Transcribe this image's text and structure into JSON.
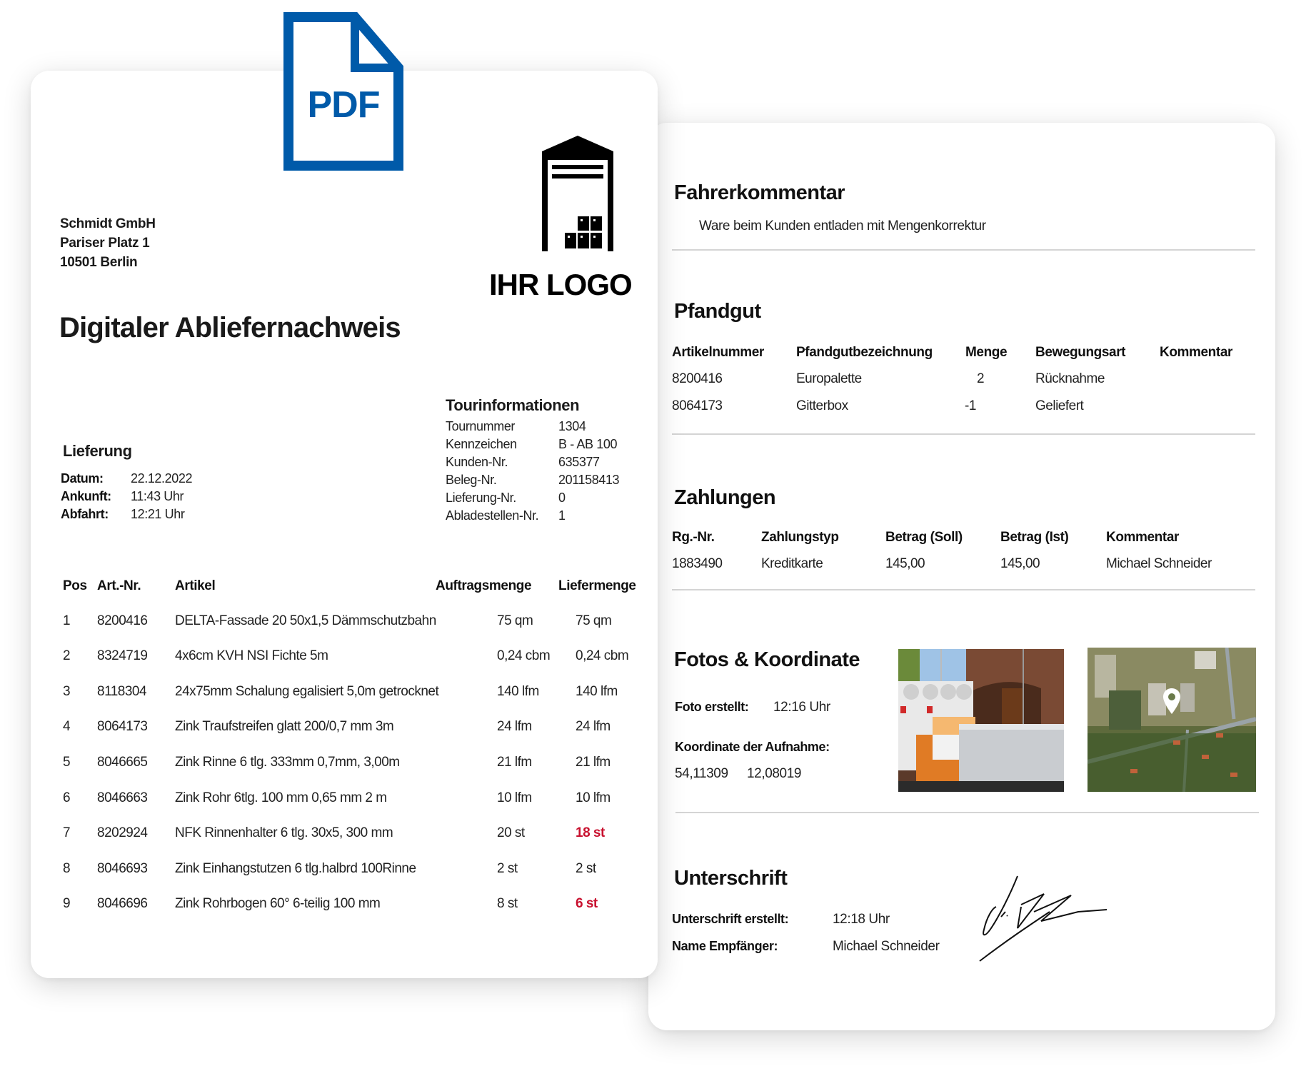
{
  "pdf_badge": {
    "label": "PDF",
    "color": "#005aa9"
  },
  "logo": {
    "text": "IHR LOGO",
    "icon": "warehouse-icon"
  },
  "sender": {
    "name": "Schmidt GmbH",
    "street": "Pariser Platz 1",
    "city": "10501 Berlin"
  },
  "document_title": "Digitaler Abliefernachweis",
  "tour_info": {
    "heading": "Tourinformationen",
    "rows": [
      {
        "label": "Tournummer",
        "value": "1304"
      },
      {
        "label": "Kennzeichen",
        "value": "B - AB 100"
      },
      {
        "label": "Kunden-Nr.",
        "value": "635377"
      },
      {
        "label": "Beleg-Nr.",
        "value": "201158413"
      },
      {
        "label": "Lieferung-Nr.",
        "value": "0"
      },
      {
        "label": "Abladestellen-Nr.",
        "value": "1"
      }
    ]
  },
  "delivery": {
    "heading": "Lieferung",
    "rows": [
      {
        "label": "Datum:",
        "value": "22.12.2022"
      },
      {
        "label": "Ankunft:",
        "value": "11:43 Uhr"
      },
      {
        "label": "Abfahrt:",
        "value": "12:21 Uhr"
      }
    ]
  },
  "items_table": {
    "headers": {
      "pos": "Pos",
      "art_nr": "Art.-Nr.",
      "artikel": "Artikel",
      "auftragsmenge": "Auftragsmenge",
      "liefermenge": "Liefermenge"
    },
    "rows": [
      {
        "pos": "1",
        "art_nr": "8200416",
        "artikel": "DELTA-Fassade 20 50x1,5 Dämmschutzbahn",
        "auftragsmenge": "75 qm",
        "liefermenge": "75 qm",
        "deviation": false
      },
      {
        "pos": "2",
        "art_nr": "8324719",
        "artikel": "4x6cm KVH NSI Fichte 5m",
        "auftragsmenge": "0,24 cbm",
        "liefermenge": "0,24 cbm",
        "deviation": false
      },
      {
        "pos": "3",
        "art_nr": "8118304",
        "artikel": "24x75mm Schalung egalisiert 5,0m getrocknet",
        "auftragsmenge": "140 lfm",
        "liefermenge": "140 lfm",
        "deviation": false
      },
      {
        "pos": "4",
        "art_nr": "8064173",
        "artikel": "Zink Traufstreifen glatt 200/0,7 mm 3m",
        "auftragsmenge": "24 lfm",
        "liefermenge": "24 lfm",
        "deviation": false
      },
      {
        "pos": "5",
        "art_nr": "8046665",
        "artikel": "Zink Rinne 6 tlg. 333mm 0,7mm, 3,00m",
        "auftragsmenge": "21 lfm",
        "liefermenge": "21 lfm",
        "deviation": false
      },
      {
        "pos": "6",
        "art_nr": "8046663",
        "artikel": "Zink Rohr 6tlg. 100 mm 0,65 mm 2 m",
        "auftragsmenge": "10 lfm",
        "liefermenge": "10 lfm",
        "deviation": false
      },
      {
        "pos": "7",
        "art_nr": "8202924",
        "artikel": "NFK Rinnenhalter 6  tlg. 30x5, 300 mm",
        "auftragsmenge": "20 st",
        "liefermenge": "18 st",
        "deviation": true
      },
      {
        "pos": "8",
        "art_nr": "8046693",
        "artikel": "Zink Einhangstutzen 6 tlg.halbrd 100Rinne",
        "auftragsmenge": "2 st",
        "liefermenge": "2 st",
        "deviation": false
      },
      {
        "pos": "9",
        "art_nr": "8046696",
        "artikel": "Zink Rohrbogen 60° 6-teilig 100 mm",
        "auftragsmenge": "8 st",
        "liefermenge": "6 st",
        "deviation": true
      }
    ],
    "deviation_color": "#c8102e"
  },
  "driver_comment": {
    "heading": "Fahrerkommentar",
    "text": "Ware beim Kunden entladen mit Mengenkorrektur"
  },
  "deposit": {
    "heading": "Pfandgut",
    "headers": [
      "Artikelnummer",
      "Pfandgutbezeichnung",
      "Menge",
      "Bewegungsart",
      "Kommentar"
    ],
    "rows": [
      [
        "8200416",
        "Europalette",
        "2",
        "Rücknahme",
        ""
      ],
      [
        "8064173",
        "Gitterbox",
        "-1",
        "Geliefert",
        ""
      ]
    ]
  },
  "payments": {
    "heading": "Zahlungen",
    "headers": [
      "Rg.-Nr.",
      "Zahlungstyp",
      "Betrag (Soll)",
      "Betrag (Ist)",
      "Kommentar"
    ],
    "rows": [
      [
        "1883490",
        "Kreditkarte",
        "145,00",
        "145,00",
        "Michael Schneider"
      ]
    ]
  },
  "photos": {
    "heading": "Fotos & Koordinate",
    "created_label": "Foto erstellt:",
    "created_value": "12:16 Uhr",
    "coord_label": "Koordinate der Aufnahme:",
    "lat": "54,11309",
    "lon": "12,08019",
    "photo_alt": "delivery-photo",
    "map_alt": "satellite-map"
  },
  "signature": {
    "heading": "Unterschrift",
    "created_label": "Unterschrift erstellt:",
    "created_value": "12:18 Uhr",
    "name_label": "Name Empfänger:",
    "name_value": "Michael Schneider"
  }
}
